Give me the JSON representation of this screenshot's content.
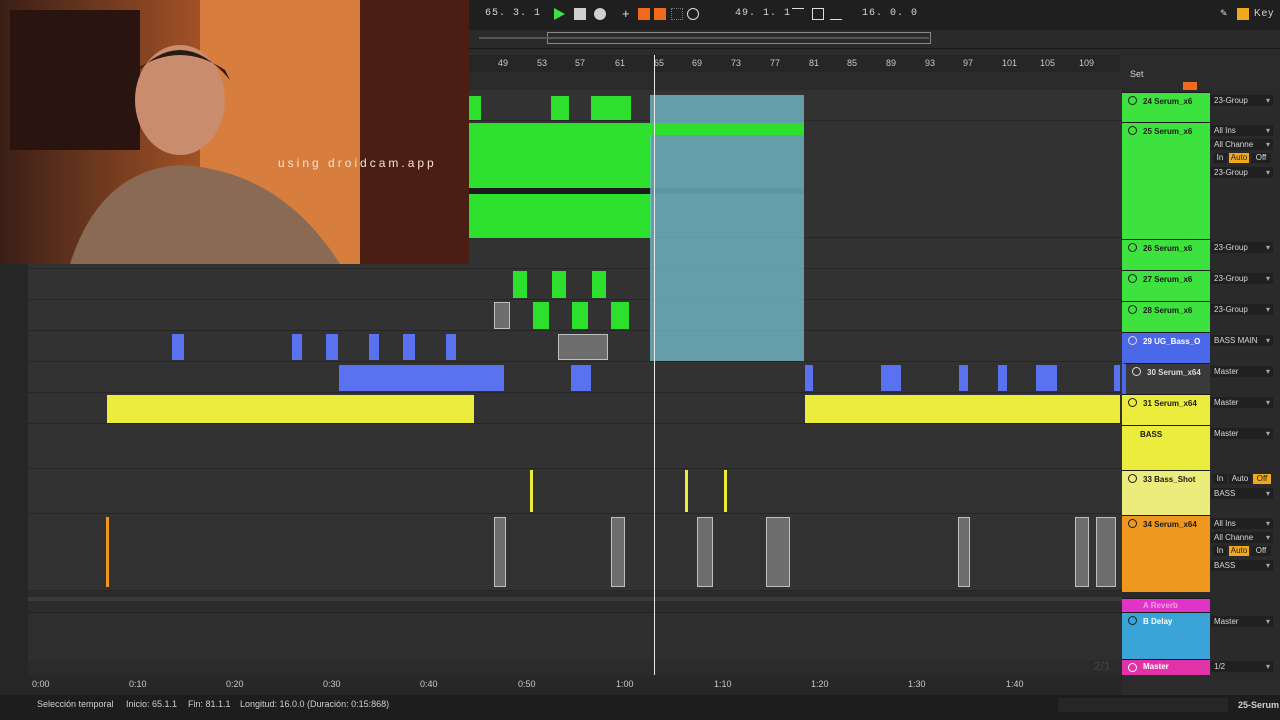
{
  "transport": {
    "position": "65.  3.  1",
    "loop_start": "49.  1.  1",
    "loop_length": "16.  0.  0",
    "key_label": "Key"
  },
  "webcam": {
    "overlay_text": "using droidcam.app"
  },
  "ruler": {
    "bars": [
      "49",
      "53",
      "57",
      "61",
      "65",
      "69",
      "73",
      "77",
      "81",
      "85",
      "89",
      "93",
      "97",
      "101",
      "105",
      "109"
    ],
    "set_label": "Set"
  },
  "time_ruler": {
    "labels": [
      "0:00",
      "0:10",
      "0:20",
      "0:30",
      "0:40",
      "0:50",
      "1:00",
      "1:10",
      "1:20",
      "1:30",
      "1:40"
    ]
  },
  "tracks": [
    {
      "name": "24 Serum_x6",
      "io": "23-Group",
      "color": "#3ee23e"
    },
    {
      "name": "25 Serum_x6",
      "io": "All Ins",
      "io2": "All Channe",
      "io3": "23-Group",
      "color": "#3ee23e"
    },
    {
      "name": "26 Serum_x6",
      "io": "23-Group",
      "color": "#3ee23e"
    },
    {
      "name": "27 Serum_x6",
      "io": "23-Group",
      "color": "#3ee23e"
    },
    {
      "name": "28 Serum_x6",
      "io": "23-Group",
      "color": "#3ee23e"
    },
    {
      "name": "29 UG_Bass_O",
      "io": "BASS MAIN",
      "color": "#4a68e8"
    },
    {
      "name": "30 Serum_x64",
      "io": "Master",
      "color": "#4a68e8"
    },
    {
      "name": "31 Serum_x64",
      "io": "Master",
      "color": "#ecec3c"
    },
    {
      "name": "BASS",
      "io": "Master",
      "color": "#ecec3c"
    },
    {
      "name": "33 Bass_Shot",
      "io": "BASS",
      "color": "#ecec7c"
    },
    {
      "name": "34 Serum_x64",
      "io": "All Ins",
      "io2": "All Channe",
      "io3": "BASS",
      "color": "#ee9820"
    },
    {
      "name": "A Reverb",
      "color": "#e033c8"
    },
    {
      "name": "B Delay",
      "io": "Master",
      "color": "#3aa4d8"
    },
    {
      "name": "Master",
      "io": "1/2",
      "color": "#e033a8"
    }
  ],
  "monitor": {
    "in": "In",
    "auto": "Auto",
    "off": "Off"
  },
  "status": {
    "mode": "Selección temporal",
    "start": "Inicio: 65.1.1",
    "end": "Fin: 81.1.1",
    "length": "Longitud: 16.0.0 (Duración: 0:15:868)",
    "right_label": "25-Serum",
    "page_indicator": "2/1"
  },
  "colors": {
    "green": "#2ee02e",
    "blue": "#5a72f0",
    "yellow": "#ecec3c",
    "orange": "#ee9820",
    "accent": "#f06a1c"
  }
}
